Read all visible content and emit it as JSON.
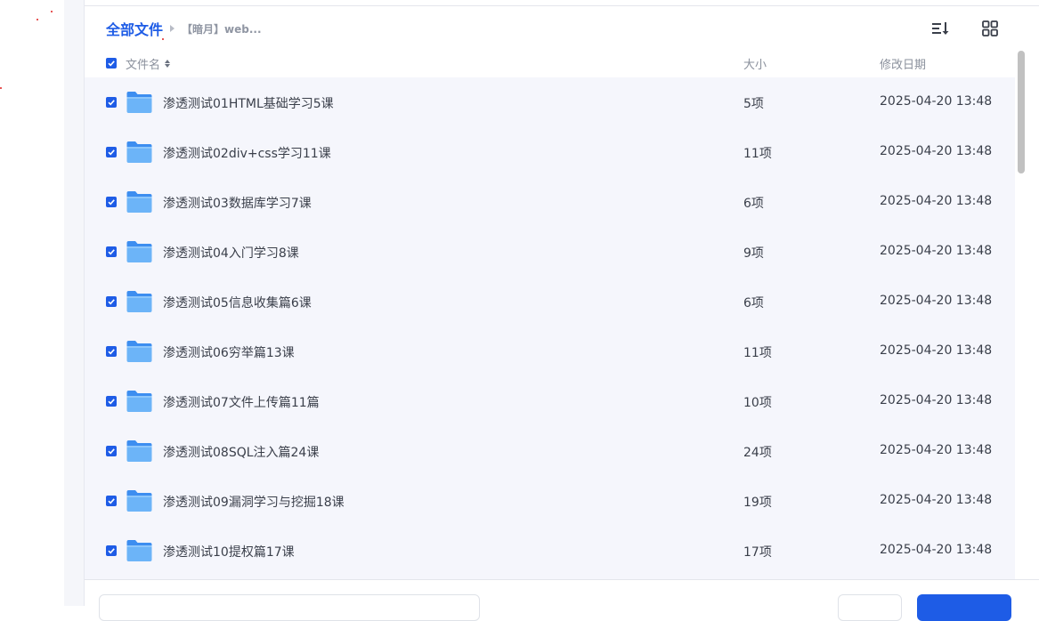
{
  "breadcrumb": {
    "root": "全部文件",
    "current": "【暗月】web..."
  },
  "toolbar": {
    "sort_icon": "sort-list-icon",
    "grid_icon": "grid-view-icon"
  },
  "columns": {
    "name": "文件名",
    "size": "大小",
    "modified": "修改日期"
  },
  "header_checked": true,
  "files": [
    {
      "name": "渗透测试01HTML基础学习5课",
      "size": "5项",
      "modified": "2025-04-20 13:48",
      "checked": true
    },
    {
      "name": "渗透测试02div+css学习11课",
      "size": "11项",
      "modified": "2025-04-20 13:48",
      "checked": true
    },
    {
      "name": "渗透测试03数据库学习7课",
      "size": "6项",
      "modified": "2025-04-20 13:48",
      "checked": true
    },
    {
      "name": "渗透测试04入门学习8课",
      "size": "9项",
      "modified": "2025-04-20 13:48",
      "checked": true
    },
    {
      "name": "渗透测试05信息收集篇6课",
      "size": "6项",
      "modified": "2025-04-20 13:48",
      "checked": true
    },
    {
      "name": "渗透测试06穷举篇13课",
      "size": "11项",
      "modified": "2025-04-20 13:48",
      "checked": true
    },
    {
      "name": "渗透测试07文件上传篇11篇",
      "size": "10项",
      "modified": "2025-04-20 13:48",
      "checked": true
    },
    {
      "name": "渗透测试08SQL注入篇24课",
      "size": "24项",
      "modified": "2025-04-20 13:48",
      "checked": true
    },
    {
      "name": "渗透测试09漏洞学习与挖掘18课",
      "size": "19项",
      "modified": "2025-04-20 13:48",
      "checked": true
    },
    {
      "name": "渗透测试10提权篇17课",
      "size": "17项",
      "modified": "2025-04-20 13:48",
      "checked": true
    }
  ],
  "colors": {
    "accent": "#1e5ce6",
    "list_bg": "#f5f6fc",
    "folder": "#5aa9f5"
  }
}
